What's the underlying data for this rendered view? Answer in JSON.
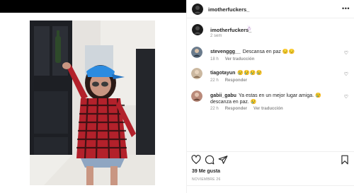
{
  "post": {
    "username": "imotherfuckers_",
    "caption_emoji": "☃",
    "caption_time": "2 sem",
    "likes": "39 Me gusta",
    "date": "NOVIEMBRE 26"
  },
  "comments": [
    {
      "user": "stevenggg__",
      "text": "Descansa en paz 😔😔",
      "time": "18 h",
      "action": "Ver traducción"
    },
    {
      "user": "tiagotayun",
      "text": "😢😢😢😢",
      "time": "22 h",
      "reply": "Responder"
    },
    {
      "user": "gabii_gabu",
      "text": "Ya estas en un mejor lugar amiga. 😢descanza en paz. 😢",
      "time": "22 h",
      "reply": "Responder",
      "action": "Ver traducción"
    }
  ],
  "labels": {
    "reply": "Responder"
  },
  "icons": {
    "more": "more-options-icon",
    "like": "heart-outline-icon",
    "comment": "comment-icon",
    "share": "share-icon",
    "save": "bookmark-icon"
  },
  "colors": {
    "secondary_text": "#8e8e8e",
    "divider": "#efefef",
    "topbar": "#000000"
  }
}
